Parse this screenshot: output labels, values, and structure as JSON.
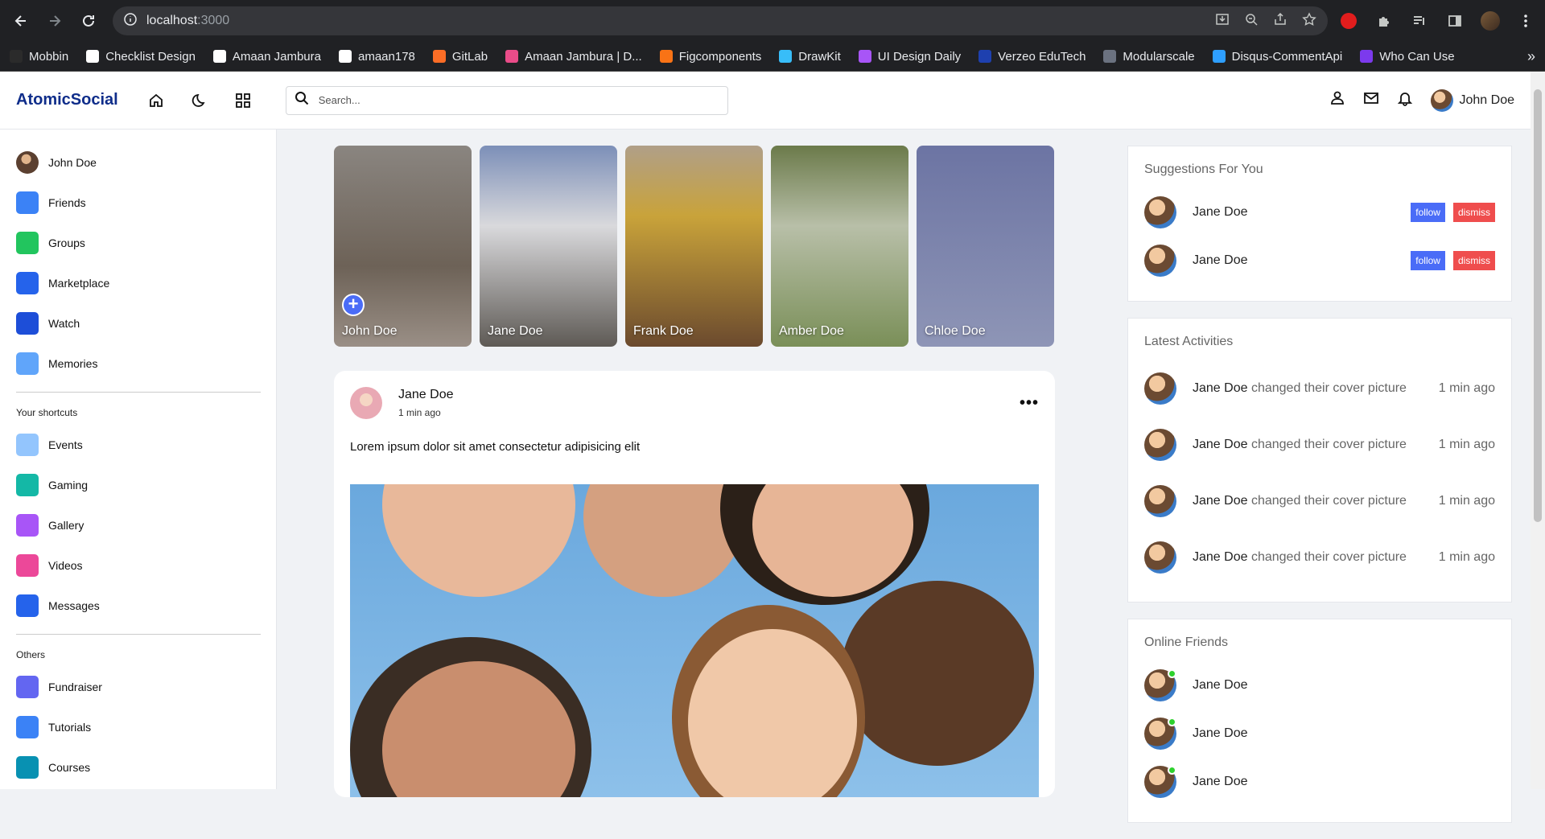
{
  "browser": {
    "url_host": "localhost",
    "url_port": ":3000",
    "bookmarks": [
      {
        "label": "Mobbin",
        "color": "#2b2b2b"
      },
      {
        "label": "Checklist Design",
        "color": "#ffffff"
      },
      {
        "label": "Amaan Jambura",
        "color": "#ffffff"
      },
      {
        "label": "amaan178",
        "color": "#ffffff"
      },
      {
        "label": "GitLab",
        "color": "#fc6d26"
      },
      {
        "label": "Amaan Jambura | D...",
        "color": "#ea4c89"
      },
      {
        "label": "Figcomponents",
        "color": "#f97316"
      },
      {
        "label": "DrawKit",
        "color": "#38bdf8"
      },
      {
        "label": "UI Design Daily",
        "color": "#a855f7"
      },
      {
        "label": "Verzeo EduTech",
        "color": "#1e40af"
      },
      {
        "label": "Modularscale",
        "color": "#6b7280"
      },
      {
        "label": "Disqus-CommentApi",
        "color": "#2e9fff"
      },
      {
        "label": "Who Can Use",
        "color": "#7c3aed"
      }
    ],
    "more_bookmarks": "»"
  },
  "header": {
    "logo": "AtomicSocial",
    "search_placeholder": "Search...",
    "user_name": "John Doe"
  },
  "sidebar": {
    "items": [
      {
        "label": "John Doe",
        "icon": "avatar-icon",
        "color": "#7a5b3a"
      },
      {
        "label": "Friends",
        "icon": "friends-icon",
        "color": "#3b82f6"
      },
      {
        "label": "Groups",
        "icon": "groups-icon",
        "color": "#22c55e"
      },
      {
        "label": "Marketplace",
        "icon": "marketplace-icon",
        "color": "#2563eb"
      },
      {
        "label": "Watch",
        "icon": "watch-icon",
        "color": "#1d4ed8"
      },
      {
        "label": "Memories",
        "icon": "memories-icon",
        "color": "#60a5fa"
      }
    ],
    "shortcuts_title": "Your shortcuts",
    "shortcuts": [
      {
        "label": "Events",
        "icon": "calendar-icon",
        "color": "#93c5fd"
      },
      {
        "label": "Gaming",
        "icon": "gamepad-icon",
        "color": "#14b8a6"
      },
      {
        "label": "Gallery",
        "icon": "gallery-icon",
        "color": "#a855f7"
      },
      {
        "label": "Videos",
        "icon": "video-camera-icon",
        "color": "#ec4899"
      },
      {
        "label": "Messages",
        "icon": "mail-icon",
        "color": "#2563eb"
      }
    ],
    "others_title": "Others",
    "others": [
      {
        "label": "Fundraiser",
        "icon": "fundraiser-icon",
        "color": "#6366f1"
      },
      {
        "label": "Tutorials",
        "icon": "tutorials-icon",
        "color": "#3b82f6"
      },
      {
        "label": "Courses",
        "icon": "courses-icon",
        "color": "#0891b2"
      }
    ]
  },
  "stories": [
    {
      "name": "John Doe",
      "bg": "linear-gradient(180deg,#8a8580,#6d6257 60%,#9a8f86)"
    },
    {
      "name": "Jane Doe",
      "bg": "linear-gradient(180deg,#7c8fb8,#d9d9dc 40%,#5e5a55)"
    },
    {
      "name": "Frank Doe",
      "bg": "linear-gradient(180deg,#b09f88,#c9a33a 35%,#6b4a2e)"
    },
    {
      "name": "Amber Doe",
      "bg": "linear-gradient(180deg,#6b7a4a,#b8bfa8 40%,#7a8f58)"
    },
    {
      "name": "Chloe Doe",
      "bg": "linear-gradient(180deg,#6c74a3,#8e95b6)"
    }
  ],
  "post": {
    "author": "Jane Doe",
    "time": "1 min ago",
    "text": "Lorem ipsum dolor sit amet consectetur adipisicing elit",
    "more": "•••"
  },
  "suggestions": {
    "title": "Suggestions For You",
    "users": [
      {
        "name": "Jane Doe",
        "follow": "follow",
        "dismiss": "dismiss"
      },
      {
        "name": "Jane Doe",
        "follow": "follow",
        "dismiss": "dismiss"
      }
    ]
  },
  "activities": {
    "title": "Latest Activities",
    "items": [
      {
        "name": "Jane Doe",
        "action": "changed their cover picture",
        "time": "1 min ago"
      },
      {
        "name": "Jane Doe",
        "action": "changed their cover picture",
        "time": "1 min ago"
      },
      {
        "name": "Jane Doe",
        "action": "changed their cover picture",
        "time": "1 min ago"
      },
      {
        "name": "Jane Doe",
        "action": "changed their cover picture",
        "time": "1 min ago"
      }
    ]
  },
  "online": {
    "title": "Online Friends",
    "friends": [
      {
        "name": "Jane Doe"
      },
      {
        "name": "Jane Doe"
      },
      {
        "name": "Jane Doe"
      }
    ]
  }
}
